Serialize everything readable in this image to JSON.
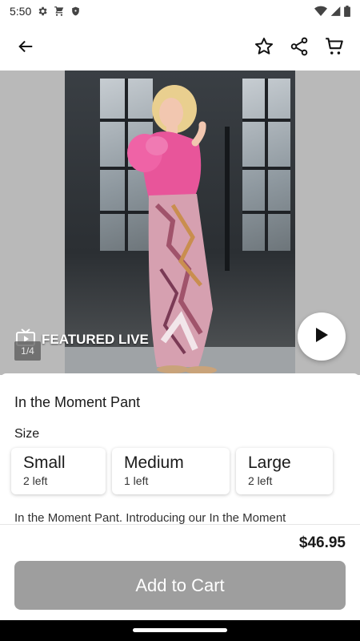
{
  "status_bar": {
    "time": "5:50",
    "icons": [
      "gear-icon",
      "cart-notification-icon",
      "shield-icon",
      "wifi-icon",
      "signal-icon",
      "battery-icon"
    ]
  },
  "app_bar": {
    "icons": [
      "back-arrow-icon",
      "star-outline-icon",
      "share-icon",
      "cart-icon"
    ]
  },
  "media": {
    "featured_label": "FEATURED LIVE",
    "counter": "1/4",
    "featured_icon": "tv-play-icon",
    "play_icon": "play-icon"
  },
  "product": {
    "title": "In the Moment Pant",
    "size_label": "Size",
    "sizes": [
      {
        "name": "Small",
        "stock": "2 left"
      },
      {
        "name": "Medium",
        "stock": "1 left"
      },
      {
        "name": "Large",
        "stock": "2 left"
      }
    ],
    "description": "In the Moment Pant. Introducing our In the Moment"
  },
  "footer": {
    "price": "$46.95",
    "add_to_cart_label": "Add to Cart"
  },
  "colors": {
    "button_disabled": "#9e9e9e",
    "top_pink": "#e8559a",
    "text": "#1a1a1a"
  }
}
